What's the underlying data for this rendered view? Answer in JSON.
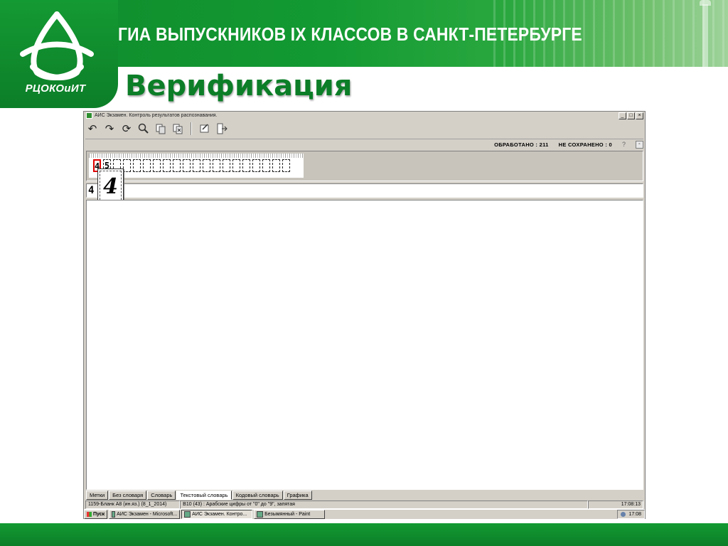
{
  "header": {
    "title": "ГИА ВЫПУСКНИКОВ IX КЛАССОВ В САНКТ-ПЕТЕРБУРГЕ",
    "logo_text": "РЦОКОиИТ",
    "brand_color": "#139a32"
  },
  "slide": {
    "title": "Верификация"
  },
  "window": {
    "title": "АИС Экзамен. Контроль результатов распознавания.",
    "controls": [
      "_",
      "□",
      "×"
    ],
    "toolbar_icons": [
      "undo-icon",
      "redo-icon",
      "refresh-icon",
      "zoom-icon",
      "copy-icon",
      "delete-icon",
      "edit-icon",
      "exit-icon"
    ],
    "status_top": {
      "processed": "ОБРАБОТАНО : 211",
      "not_saved": "НЕ СОХРАНЕНО : 0",
      "help": "?"
    },
    "answer_value": "4",
    "tabs": [
      "Метки",
      "Без словаря",
      "Словарь",
      "Текстовый словарь",
      "Кодовый словарь",
      "Графика"
    ],
    "active_tab": "Текстовый словарь",
    "status_bottom": {
      "form": "1159-Бланк А8 (ин.яз.) (8_1_2014)",
      "field": "В10 (43) : Арабские цифры от \"0\" до \"9\", запятая",
      "time": "17:08:13"
    }
  },
  "taskbar": {
    "start": "Пуск",
    "tasks": [
      "АИС Экзамен - Microsoft...",
      "АИС Экзамен. Контро...",
      "Безымянный - Paint"
    ],
    "clock": "17:08"
  }
}
